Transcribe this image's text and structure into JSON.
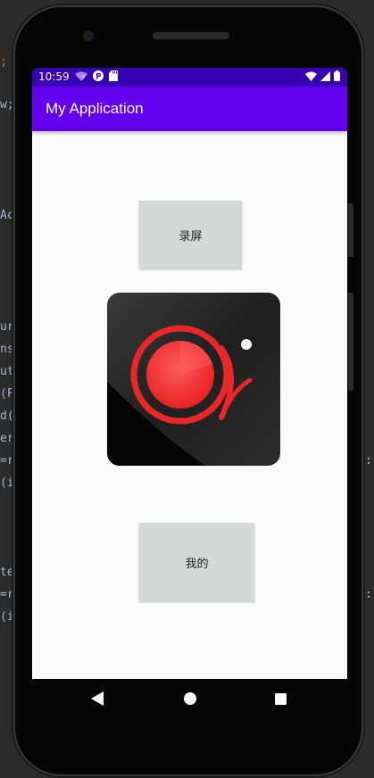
{
  "editor_fragments": [
    {
      "text": ";",
      "kw": true
    },
    {
      "text": "w;",
      "kw": false
    },
    {
      "text": "Ac",
      "kw": false
    },
    {
      "text": "ur",
      "kw": false
    },
    {
      "text": "ns",
      "kw": false
    },
    {
      "text": "ut",
      "kw": false
    },
    {
      "text": "(F",
      "kw": false
    },
    {
      "text": "d(",
      "kw": false
    },
    {
      "text": "er",
      "kw": false
    },
    {
      "text": "=r",
      "kw": false
    },
    {
      "text": "(i",
      "kw": false
    },
    {
      "text": "te",
      "kw": false
    },
    {
      "text": "=r",
      "kw": false
    },
    {
      "text": "(i",
      "kw": false
    }
  ],
  "status_bar": {
    "time": "10:59",
    "left_icons": [
      "wifi-question-icon",
      "p-badge-icon",
      "sd-card-icon"
    ],
    "right_icons": [
      "wifi-icon",
      "signal-icon",
      "battery-icon"
    ]
  },
  "app_bar": {
    "title": "My Application"
  },
  "main": {
    "record_button_label": "录屏",
    "mine_button_label": "我的",
    "logo_icon": "screen-recorder-logo-icon"
  },
  "nav_bar": {
    "back_icon": "back-triangle-icon",
    "home_icon": "home-circle-icon",
    "recents_icon": "recents-square-icon"
  },
  "colors": {
    "status_bar": "#3700b3",
    "app_bar": "#6200ee",
    "button_bg": "#d6d7d7",
    "screen_bg": "#fafafa",
    "logo_red": "#ff3b3b"
  }
}
